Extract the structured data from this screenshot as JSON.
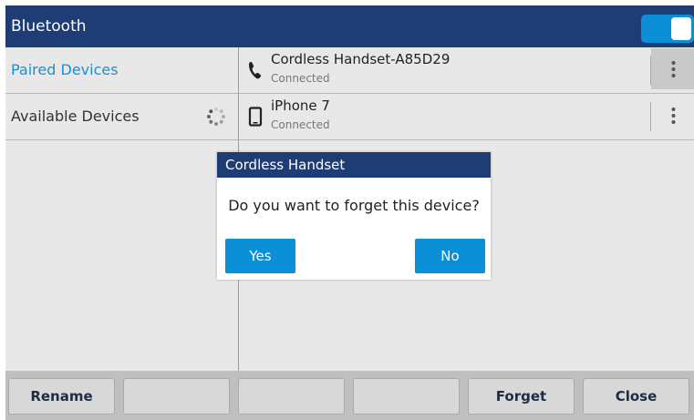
{
  "header": {
    "title": "Bluetooth",
    "toggle_on": true
  },
  "sidebar": {
    "items": [
      {
        "label": "Paired Devices",
        "active": true
      },
      {
        "label": "Available Devices",
        "active": false,
        "icon": "spinner-icon"
      }
    ]
  },
  "devices": [
    {
      "name": "Cordless Handset-A85D29",
      "status": "Connected",
      "icon": "phone-handset-icon"
    },
    {
      "name": "iPhone 7",
      "status": "Connected",
      "icon": "mobile-phone-icon"
    }
  ],
  "dialog": {
    "title": "Cordless Handset",
    "message": "Do you want to forget this device?",
    "yes_label": "Yes",
    "no_label": "No"
  },
  "softkeys": [
    "Rename",
    "",
    "",
    "",
    "Forget",
    "Close"
  ],
  "colors": {
    "header": "#1e3d74",
    "accent": "#0b8fd6",
    "active_text": "#1c8fd2"
  }
}
